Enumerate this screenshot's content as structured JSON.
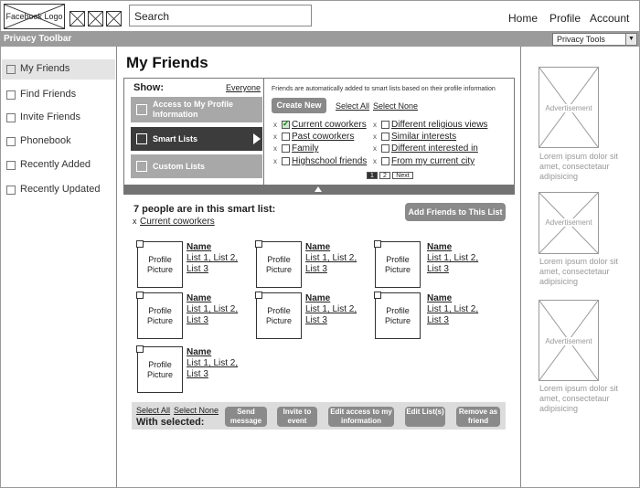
{
  "header": {
    "logo": "Facebook Logo",
    "search_placeholder": "Search",
    "nav": [
      "Home",
      "Profile",
      "Account"
    ]
  },
  "privacy_toolbar": {
    "label": "Privacy Toolbar",
    "dropdown_value": "Privacy Tools"
  },
  "sidebar": {
    "items": [
      {
        "label": "My Friends"
      },
      {
        "label": "Find Friends"
      },
      {
        "label": "Invite Friends"
      },
      {
        "label": "Phonebook"
      },
      {
        "label": "Recently Added"
      },
      {
        "label": "Recently Updated"
      }
    ]
  },
  "main": {
    "title": "My Friends",
    "panel": {
      "show_label": "Show:",
      "everyone": "Everyone",
      "tabs": [
        {
          "label": "Access to My Profile Information"
        },
        {
          "label": "Smart Lists"
        },
        {
          "label": "Custom Lists"
        }
      ],
      "info": "Friends are automatically added to smart lists based on their profile information",
      "create_new": "Create New",
      "select_all": "Select All",
      "select_none": "Select None",
      "options_left": [
        {
          "label": "Current coworkers",
          "checked": true
        },
        {
          "label": "Past coworkers",
          "checked": false
        },
        {
          "label": "Family",
          "checked": false
        },
        {
          "label": "Highschool friends",
          "checked": false
        }
      ],
      "options_right": [
        {
          "label": "Different religious views",
          "checked": false
        },
        {
          "label": "Similar interests",
          "checked": false
        },
        {
          "label": "Different interested in",
          "checked": false
        },
        {
          "label": "From my current city",
          "checked": false
        }
      ],
      "pagination": [
        "1",
        "2",
        "Next"
      ],
      "remove_mark": "x"
    },
    "people": {
      "count_text": "7 people are in this smart list:",
      "filter_x": "x",
      "filter": "Current coworkers",
      "add_button": "Add Friends to This List",
      "picture_label": "Profile Picture",
      "name": "Name",
      "lists": "List 1, List 2, List 3"
    },
    "actions": {
      "select_all": "Select All",
      "select_none": "Select None",
      "with_selected": "With selected:",
      "buttons": [
        "Send message",
        "Invite to event",
        "Edit access to my information",
        "Edit List(s)",
        "Remove as friend"
      ]
    }
  },
  "ads": {
    "label": "Advertisement",
    "text": "Lorem ipsum dolor sit amet, consectetaur adipisicing"
  }
}
